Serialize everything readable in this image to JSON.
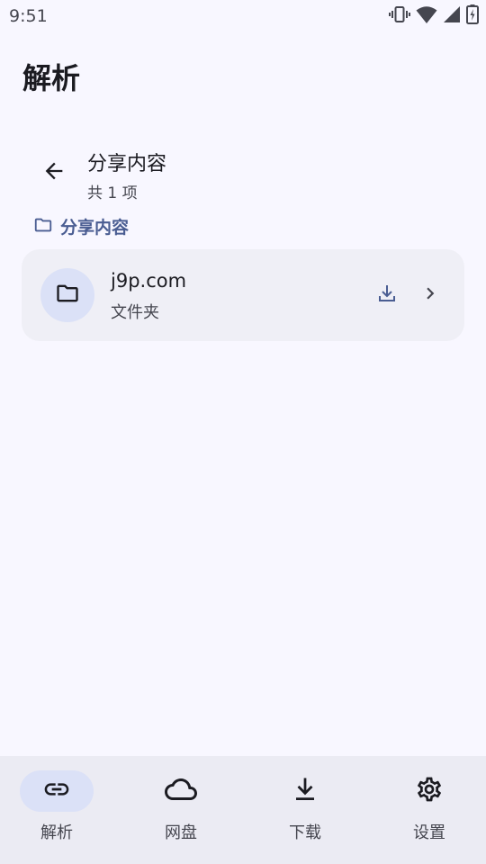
{
  "status_bar": {
    "time": "9:51",
    "icons": [
      "vibrate-icon",
      "wifi-icon",
      "cellular-signal-icon",
      "battery-charging-icon"
    ]
  },
  "page": {
    "title": "解析"
  },
  "header": {
    "title": "分享内容",
    "count": "共 1 项",
    "back_icon": "arrow-left-icon"
  },
  "breadcrumb": {
    "icon": "folder-icon",
    "label": "分享内容",
    "color": "#4a5d92"
  },
  "files": [
    {
      "name": "j9p.com",
      "type": "文件夹",
      "icon": "folder-icon",
      "actions": [
        "download-icon",
        "chevron-right-icon"
      ]
    }
  ],
  "bottom_nav": {
    "items": [
      {
        "label": "解析",
        "icon": "link-icon",
        "active": true
      },
      {
        "label": "网盘",
        "icon": "cloud-icon",
        "active": false
      },
      {
        "label": "下载",
        "icon": "download-icon",
        "active": false
      },
      {
        "label": "设置",
        "icon": "gear-icon",
        "active": false
      }
    ]
  },
  "colors": {
    "background": "#f8f7ff",
    "accent": "#4a5d92",
    "card": "#efeff6",
    "active_pill": "#dbe1f7",
    "nav_background": "#ebebf3"
  }
}
